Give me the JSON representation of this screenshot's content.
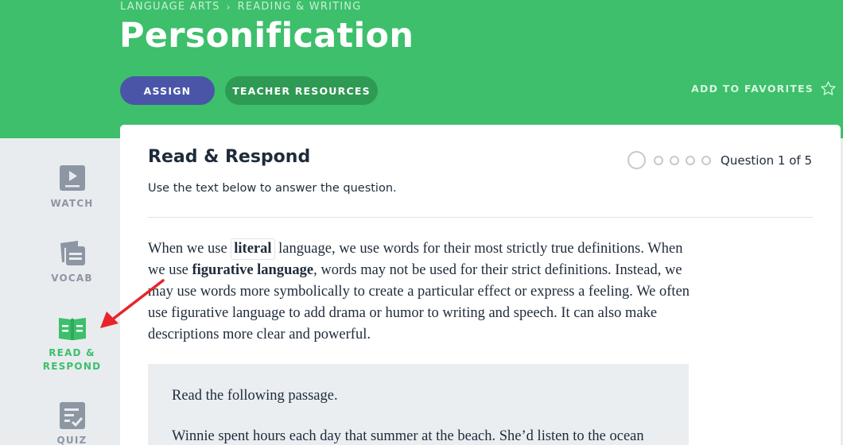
{
  "header": {
    "breadcrumb": [
      "LANGUAGE ARTS",
      "READING & WRITING"
    ],
    "breadcrumb_sep": "›",
    "title": "Personification",
    "assign_label": "ASSIGN",
    "resources_label": "TEACHER RESOURCES",
    "favorites_label": "ADD TO FAVORITES",
    "accent_color": "#3dbf6b",
    "assign_color": "#4a55a8"
  },
  "sidebar": {
    "items": [
      {
        "label": "WATCH",
        "icon": "video-icon",
        "active": false
      },
      {
        "label": "VOCAB",
        "icon": "vocab-cards-icon",
        "active": false
      },
      {
        "label": "READ & RESPOND",
        "icon": "open-book-icon",
        "active": true
      },
      {
        "label": "QUIZ",
        "icon": "checklist-icon",
        "active": false
      }
    ]
  },
  "main": {
    "section_title": "Read & Respond",
    "instructions": "Use the text below to answer the question.",
    "progress": {
      "current": 1,
      "total": 5,
      "label": "Question 1 of 5"
    },
    "paragraph": {
      "p1": "When we use ",
      "term1": "literal",
      "p2": " language, we use words for their most strictly true definitions. When we use ",
      "term2": "figurative language",
      "p3": ", words may not be used for their strict definitions. Instead, we may use words more symbolically to create a particular effect or express a feeling. We often use figurative language to add drama or humor to writing and speech. It can also make descriptions more clear and powerful."
    },
    "passage": {
      "intro": "Read the following passage.",
      "text": "Winnie spent hours each day that summer at the beach. She’d listen to the ocean"
    }
  },
  "annotation": {
    "arrow_color": "#e8242a",
    "points_to": "READ & RESPOND"
  }
}
